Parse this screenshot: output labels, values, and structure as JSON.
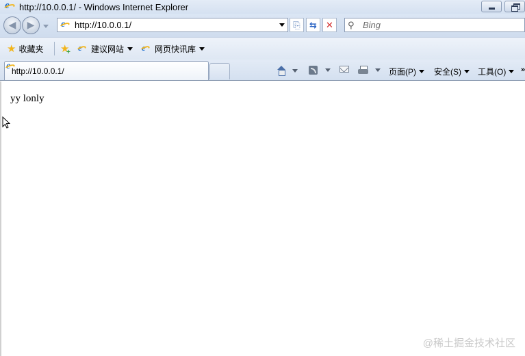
{
  "window": {
    "title": "http://10.0.0.1/ - Windows Internet Explorer"
  },
  "address_bar": {
    "url": "http://10.0.0.1/"
  },
  "search": {
    "placeholder": "Bing"
  },
  "favorites_bar": {
    "favorites_label": "收藏夹",
    "items": [
      {
        "label": "建议网站"
      },
      {
        "label": "网页快讯库"
      }
    ]
  },
  "tabs": [
    {
      "label": "http://10.0.0.1/"
    }
  ],
  "command_bar": {
    "page_label": "页面(P)",
    "safety_label": "安全(S)",
    "tools_label": "工具(O)",
    "more_label": "»"
  },
  "page": {
    "body_text": "yy lonly"
  },
  "watermark": "@稀土掘金技术社区",
  "colors": {
    "chrome_blue": "#d5e1f1",
    "ie_blue": "#1c6fd1",
    "ie_gold": "#f2b51b",
    "stop_red": "#d22b2b"
  }
}
